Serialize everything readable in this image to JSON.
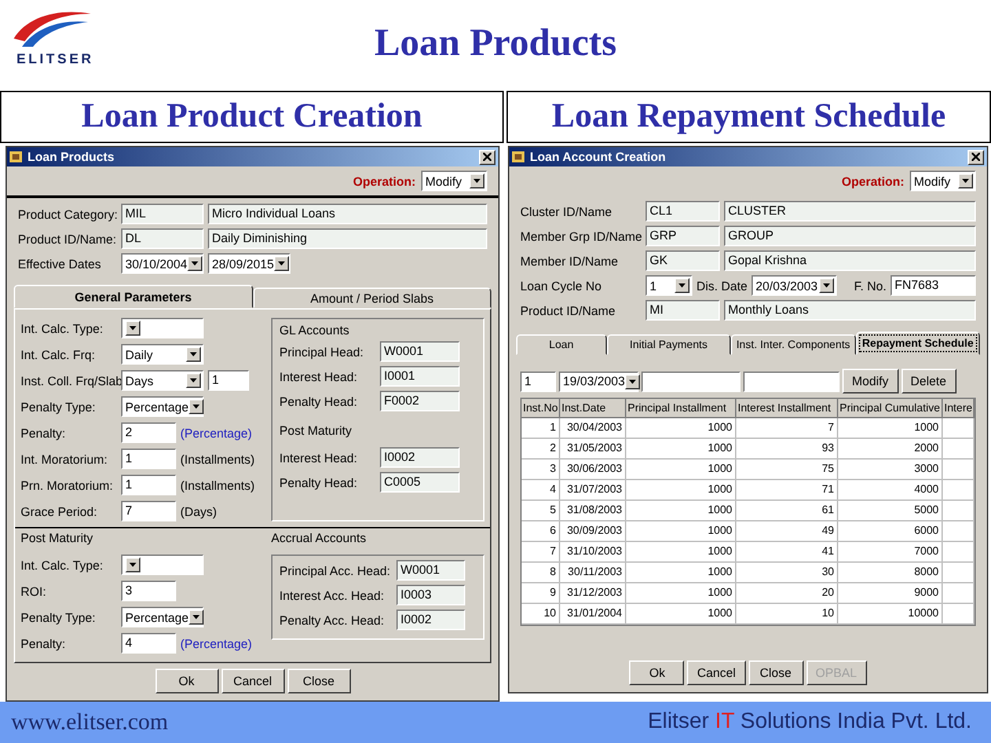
{
  "logo_text": "ELITSER",
  "title": "Loan Products",
  "captions": [
    "Loan Product Creation",
    "Loan Repayment Schedule"
  ],
  "left_window": {
    "title": "Loan Products",
    "operation": {
      "label": "Operation:",
      "value": "Modify"
    },
    "fields": [
      {
        "label": "Product Category:",
        "kind": "text",
        "values": [
          "MIL",
          "Micro Individual Loans"
        ]
      },
      {
        "label": "Product ID/Name:",
        "kind": "text",
        "values": [
          "DL",
          "Daily Diminishing"
        ]
      },
      {
        "label": "Effective Dates",
        "kind": "date",
        "values": [
          "30/10/2004",
          "28/09/2015"
        ]
      }
    ],
    "tabs": [
      {
        "label": "General Parameters",
        "selected": true
      },
      {
        "label": "Amount / Period Slabs",
        "selected": false
      }
    ],
    "general": [
      {
        "label": "Int. Calc. Type:",
        "kind": "select"
      },
      {
        "label": "Int. Calc. Frq:",
        "kind": "select",
        "value": "Daily"
      },
      {
        "label": "Inst. Coll. Frq/Slab",
        "kind": "select",
        "value": "Days",
        "extra": "1"
      },
      {
        "label": "Penalty Type:",
        "kind": "select",
        "value": "Percentage"
      },
      {
        "label": "Penalty:",
        "kind": "input",
        "value": "2",
        "note": "(Percentage)",
        "note_highlight": true
      },
      {
        "label": "Int. Moratorium:",
        "kind": "input",
        "value": "1",
        "note": "(Installments)",
        "note_highlight": false
      },
      {
        "label": "Prn. Moratorium:",
        "kind": "input",
        "value": "1",
        "note": "(Installments)",
        "note_highlight": false
      },
      {
        "label": "Grace Period:",
        "kind": "input",
        "value": "7",
        "note": "(Days)",
        "note_highlight": false
      }
    ],
    "gl_accounts": {
      "title": "GL Accounts",
      "rows": [
        {
          "label": "Principal Head:",
          "value": "W0001"
        },
        {
          "label": "Interest Head:",
          "value": "I0001"
        },
        {
          "label": "Penalty Head:",
          "value": "F0002"
        }
      ],
      "sub_title": "Post Maturity",
      "sub_rows": [
        {
          "label": "Interest Head:",
          "value": "I0002"
        },
        {
          "label": "Penalty Head:",
          "value": "C0005"
        }
      ]
    },
    "post_maturity": {
      "title": "Post Maturity",
      "rows": [
        {
          "label": "Int. Calc. Type:",
          "kind": "select"
        },
        {
          "label": "ROI:",
          "kind": "input",
          "value": "3"
        },
        {
          "label": "Penalty Type:",
          "kind": "select",
          "value": "Percentage"
        },
        {
          "label": "Penalty:",
          "kind": "input",
          "value": "4",
          "note": "(Percentage)",
          "note_highlight": true
        }
      ]
    },
    "accrual_accounts": {
      "title": "Accrual Accounts",
      "rows": [
        {
          "label": "Principal Acc. Head:",
          "value": "W0001"
        },
        {
          "label": "Interest Acc. Head:",
          "value": "I0003"
        },
        {
          "label": "Penalty Acc. Head:",
          "value": "I0002"
        }
      ]
    },
    "buttons": [
      {
        "label": "Ok",
        "disabled": false
      },
      {
        "label": "Cancel",
        "disabled": false
      },
      {
        "label": "Close",
        "disabled": false
      }
    ]
  },
  "right_window": {
    "title": "Loan Account Creation",
    "operation": {
      "label": "Operation:",
      "value": "Modify"
    },
    "fields": [
      {
        "kind": "pair",
        "label": "Cluster ID/Name",
        "values": [
          "CL1",
          "CLUSTER"
        ]
      },
      {
        "kind": "pair",
        "label": "Member Grp ID/Name",
        "values": [
          "GRP",
          "GROUP"
        ]
      },
      {
        "kind": "pair",
        "label": "Member ID/Name",
        "values": [
          "GK",
          "Gopal Krishna"
        ]
      },
      {
        "kind": "cycle",
        "label": "Loan Cycle No",
        "value": "1",
        "date_label": "Dis. Date",
        "date": "20/03/2003",
        "fno_label": "F. No.",
        "fno": "FN7683"
      },
      {
        "kind": "pair",
        "label": "Product ID/Name",
        "values": [
          "MI",
          "Monthly Loans"
        ]
      }
    ],
    "tabs": [
      {
        "label": "Loan",
        "selected": false
      },
      {
        "label": "Initial Payments",
        "selected": false
      },
      {
        "label": "Inst. Inter. Components",
        "selected": false
      },
      {
        "label": "Repayment Schedule",
        "selected": true
      }
    ],
    "entry": {
      "inst": "1",
      "date": "19/03/2003",
      "buttons": [
        "Modify",
        "Delete"
      ]
    },
    "table": {
      "columns": [
        "Inst.No",
        "Inst.Date",
        "Principal Installment",
        "Interest Installment",
        "Principal Cumulative",
        "Intere"
      ],
      "rows": [
        [
          "1",
          "30/04/2003",
          "1000",
          "7",
          "1000"
        ],
        [
          "2",
          "31/05/2003",
          "1000",
          "93",
          "2000"
        ],
        [
          "3",
          "30/06/2003",
          "1000",
          "75",
          "3000"
        ],
        [
          "4",
          "31/07/2003",
          "1000",
          "71",
          "4000"
        ],
        [
          "5",
          "31/08/2003",
          "1000",
          "61",
          "5000"
        ],
        [
          "6",
          "30/09/2003",
          "1000",
          "49",
          "6000"
        ],
        [
          "7",
          "31/10/2003",
          "1000",
          "41",
          "7000"
        ],
        [
          "8",
          "30/11/2003",
          "1000",
          "30",
          "8000"
        ],
        [
          "9",
          "31/12/2003",
          "1000",
          "20",
          "9000"
        ],
        [
          "10",
          "31/01/2004",
          "1000",
          "10",
          "10000"
        ]
      ]
    },
    "buttons": [
      {
        "label": "Ok",
        "disabled": false
      },
      {
        "label": "Cancel",
        "disabled": false
      },
      {
        "label": "Close",
        "disabled": false
      },
      {
        "label": "OPBAL",
        "disabled": true
      }
    ]
  },
  "footer": {
    "url": "www.elitser.com",
    "company": [
      {
        "text": "Elitser",
        "highlight": false
      },
      {
        "text": "IT",
        "highlight": true
      },
      {
        "text": "Solutions India Pvt. Ltd.",
        "highlight": false
      }
    ]
  }
}
